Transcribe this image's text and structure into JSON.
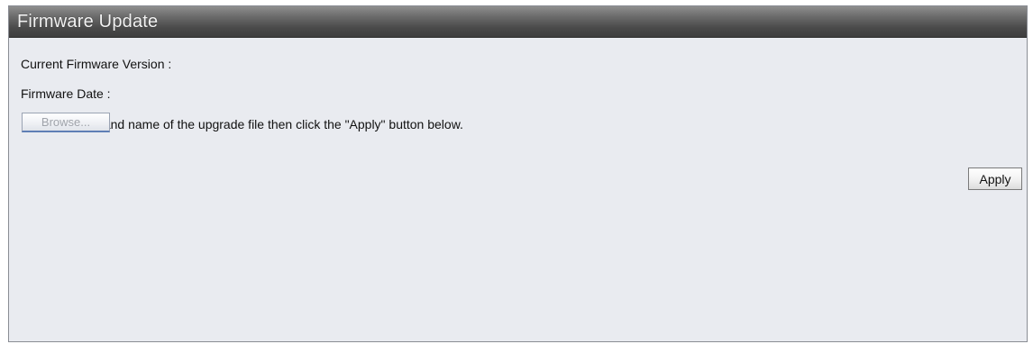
{
  "panel": {
    "title": "Firmware Update"
  },
  "firmware": {
    "current_version_label": "Current Firmware Version :",
    "date_label": "Firmware Date :",
    "instructions": "Enter the path and name of the upgrade file then click the \"Apply\" button below."
  },
  "buttons": {
    "browse_label": "Browse...",
    "apply_label": "Apply"
  }
}
